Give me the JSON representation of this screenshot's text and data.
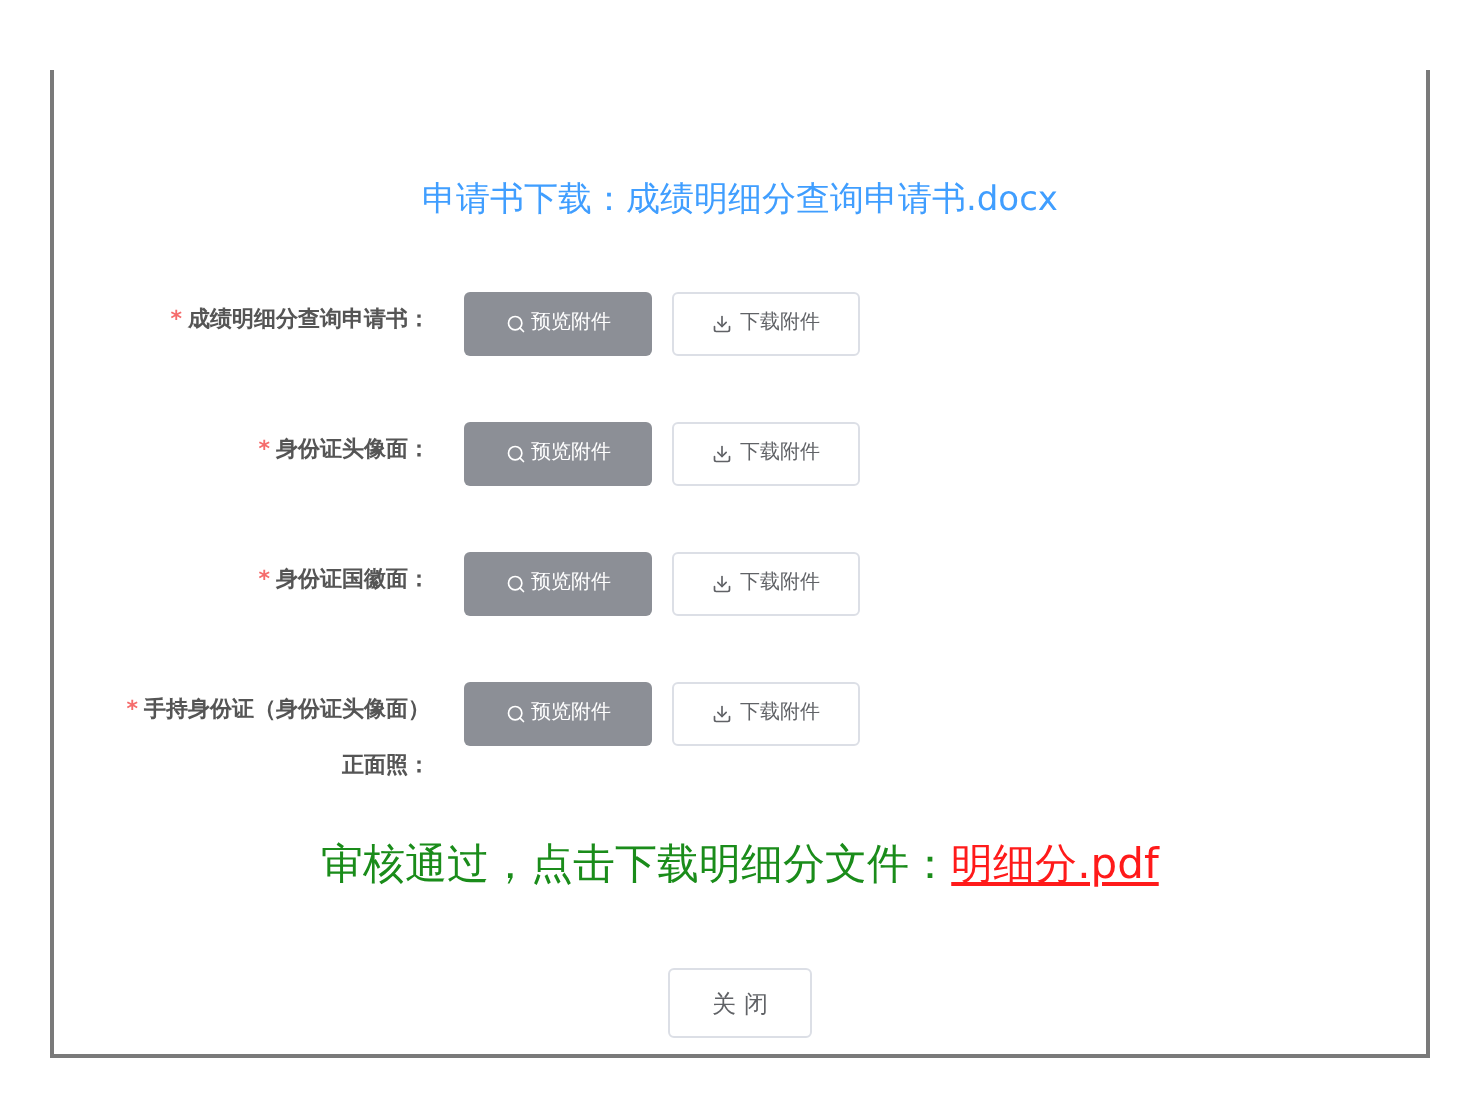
{
  "dialog": {
    "title": "申请书下载：成绩明细分查询申请书.docx",
    "fields": [
      {
        "marker": "*",
        "label": "成绩明细分查询申请书：",
        "preview": "预览附件",
        "download": "下载附件"
      },
      {
        "marker": "*",
        "label": "身份证头像面：",
        "preview": "预览附件",
        "download": "下载附件"
      },
      {
        "marker": "*",
        "label": "身份证国徽面：",
        "preview": "预览附件",
        "download": "下载附件"
      },
      {
        "marker": "*",
        "label": "手持身份证（身份证头像面）正面照：",
        "preview": "预览附件",
        "download": "下载附件"
      }
    ],
    "result": {
      "text": "审核通过，点击下载明细分文件：",
      "link": "明细分.pdf"
    },
    "close_button": "关 闭"
  }
}
